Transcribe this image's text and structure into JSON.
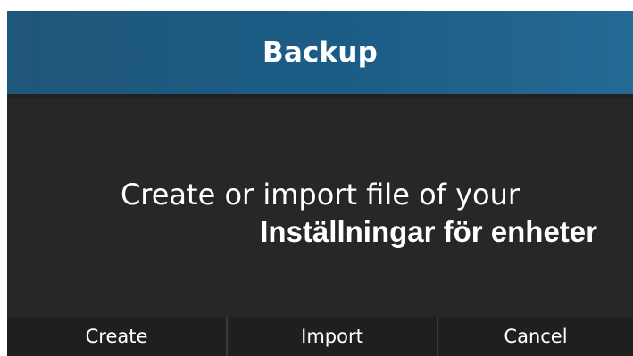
{
  "dialog": {
    "title": "Backup",
    "message_line1": "Create or import file of your",
    "message_line2": "Inställningar för enheter",
    "buttons": {
      "create": "Create",
      "import": "Import",
      "cancel": "Cancel"
    }
  },
  "colors": {
    "header_bg": "#1b5d87",
    "dialog_bg": "#272727",
    "button_bar_bg": "#1f1f1f",
    "text": "#ffffff"
  }
}
